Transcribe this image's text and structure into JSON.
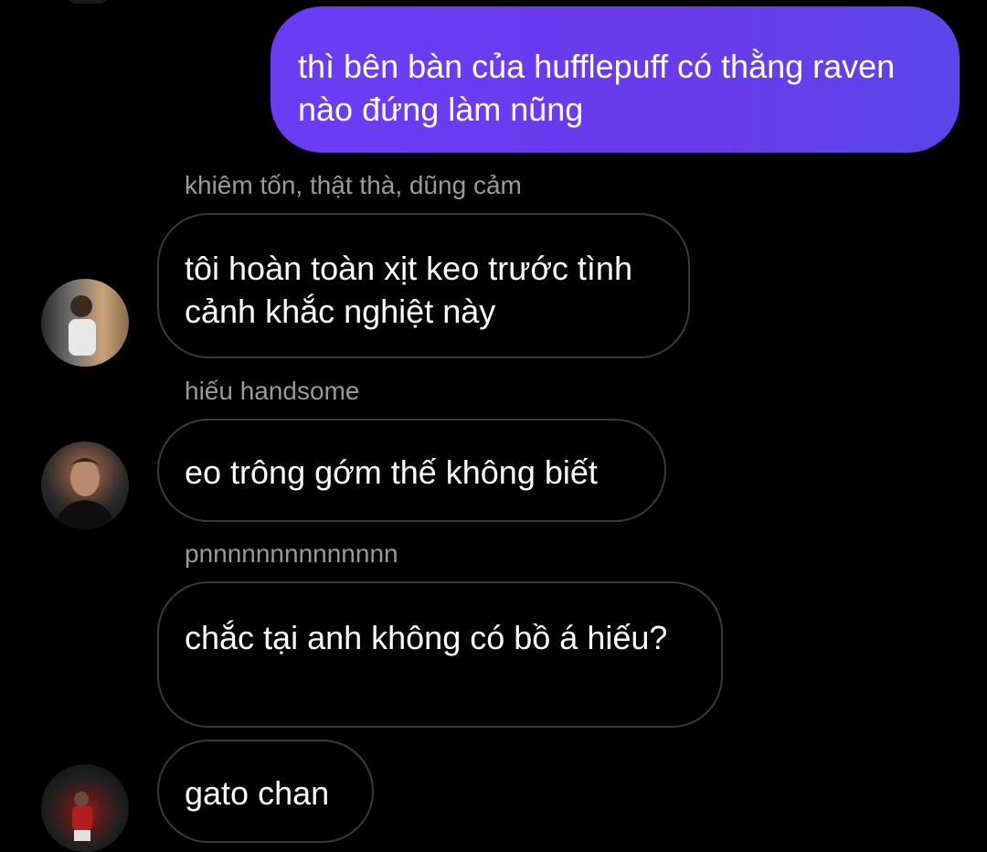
{
  "messages": {
    "sent_1": "thì bên bàn của hufflepuff có thằng raven nào đứng làm nũng",
    "sender_1": "khiêm tốn, thật thà, dũng cảm",
    "received_1": "tôi hoàn toàn xịt keo trước tình cảnh khắc nghiệt này",
    "sender_2": "hiếu handsome",
    "received_2": "eo trông gớm thế không biết",
    "sender_3": "pnnnnnnnnnnnnnn",
    "received_3": "chắc tại anh không có bồ á hiếu?",
    "received_4": "gato chan"
  },
  "colors": {
    "background": "#000000",
    "sent_bubble_start": "#6a3cf5",
    "sent_bubble_end": "#5a46ea",
    "received_bubble_border": "#3a3a3a",
    "sender_name": "#9a9a9a"
  }
}
